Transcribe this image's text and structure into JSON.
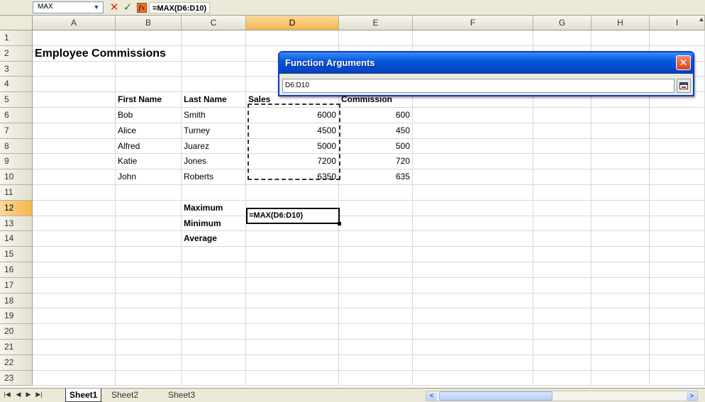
{
  "formula_bar": {
    "name_box": "MAX",
    "formula": "=MAX(D6:D10)",
    "cancel_icon": "x-icon",
    "enter_icon": "check-icon",
    "fx_label": "fx"
  },
  "columns": [
    "A",
    "B",
    "C",
    "D",
    "E",
    "F",
    "G",
    "H",
    "I"
  ],
  "rows": [
    "1",
    "2",
    "3",
    "4",
    "5",
    "6",
    "7",
    "8",
    "9",
    "10",
    "11",
    "12",
    "13",
    "14",
    "15",
    "16",
    "17",
    "18",
    "19",
    "20",
    "21",
    "22",
    "23"
  ],
  "sheet": {
    "title": "Employee Commissions",
    "headers": {
      "first_name": "First Name",
      "last_name": "Last Name",
      "sales": "Sales",
      "commission": "Commission"
    },
    "records": [
      {
        "first": "Bob",
        "last": "Smith",
        "sales": "6000",
        "commission": "600"
      },
      {
        "first": "Alice",
        "last": "Turney",
        "sales": "4500",
        "commission": "450"
      },
      {
        "first": "Alfred",
        "last": "Juarez",
        "sales": "5000",
        "commission": "500"
      },
      {
        "first": "Katie",
        "last": "Jones",
        "sales": "7200",
        "commission": "720"
      },
      {
        "first": "John",
        "last": "Roberts",
        "sales": "6350",
        "commission": "635"
      }
    ],
    "stats": {
      "maximum": "Maximum",
      "minimum": "Minimum",
      "average": "Average"
    },
    "active_cell_value": "=MAX(D6:D10)"
  },
  "dialog": {
    "title": "Function Arguments",
    "input_value": "D6:D10",
    "close_label": "✕"
  },
  "tabs": {
    "sheets": [
      "Sheet1",
      "Sheet2",
      "Sheet3"
    ],
    "active": "Sheet1"
  },
  "colors": {
    "selected_header": "#f4b64c",
    "dialog_title": "#0658dd",
    "close_button": "#d9451e"
  }
}
